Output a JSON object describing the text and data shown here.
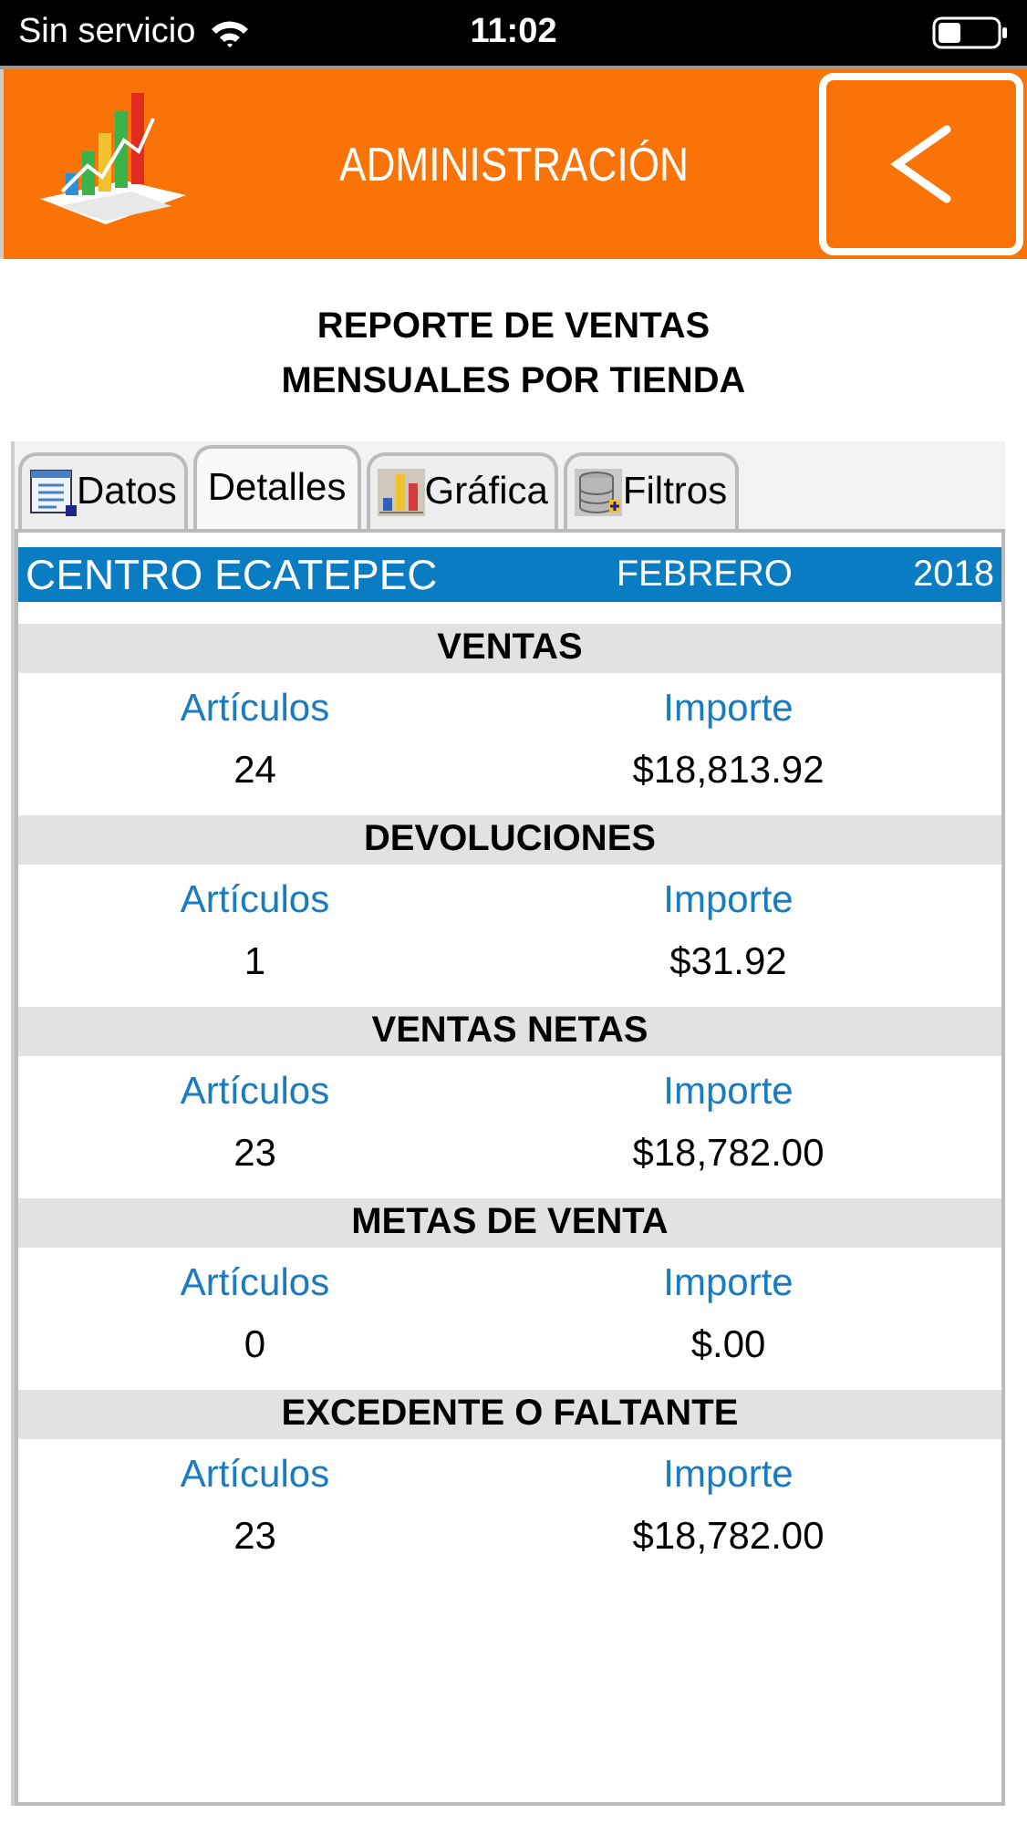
{
  "status_bar": {
    "carrier": "Sin servicio",
    "time": "11:02"
  },
  "header": {
    "title": "ADMINISTRACIÓN"
  },
  "report_title": [
    "REPORTE DE VENTAS",
    "MENSUALES POR TIENDA"
  ],
  "tabs": [
    {
      "label": "Datos",
      "selected": false
    },
    {
      "label": "Detalles",
      "selected": true
    },
    {
      "label": "Gráfica",
      "selected": false
    },
    {
      "label": "Filtros",
      "selected": false
    }
  ],
  "info_bar": {
    "store": "CENTRO ECATEPEC",
    "month": "FEBRERO",
    "year": "2018"
  },
  "sections": [
    {
      "title": "VENTAS",
      "articles_label": "Artículos",
      "amount_label": "Importe",
      "articles": "24",
      "amount": "$18,813.92"
    },
    {
      "title": "DEVOLUCIONES",
      "articles_label": "Artículos",
      "amount_label": "Importe",
      "articles": "1",
      "amount": "$31.92"
    },
    {
      "title": "VENTAS NETAS",
      "articles_label": "Artículos",
      "amount_label": "Importe",
      "articles": "23",
      "amount": "$18,782.00"
    },
    {
      "title": "METAS DE VENTA",
      "articles_label": "Artículos",
      "amount_label": "Importe",
      "articles": "0",
      "amount": "$.00"
    },
    {
      "title": "EXCEDENTE O FALTANTE",
      "articles_label": "Artículos",
      "amount_label": "Importe",
      "articles": "23",
      "amount": "$18,782.00"
    }
  ]
}
